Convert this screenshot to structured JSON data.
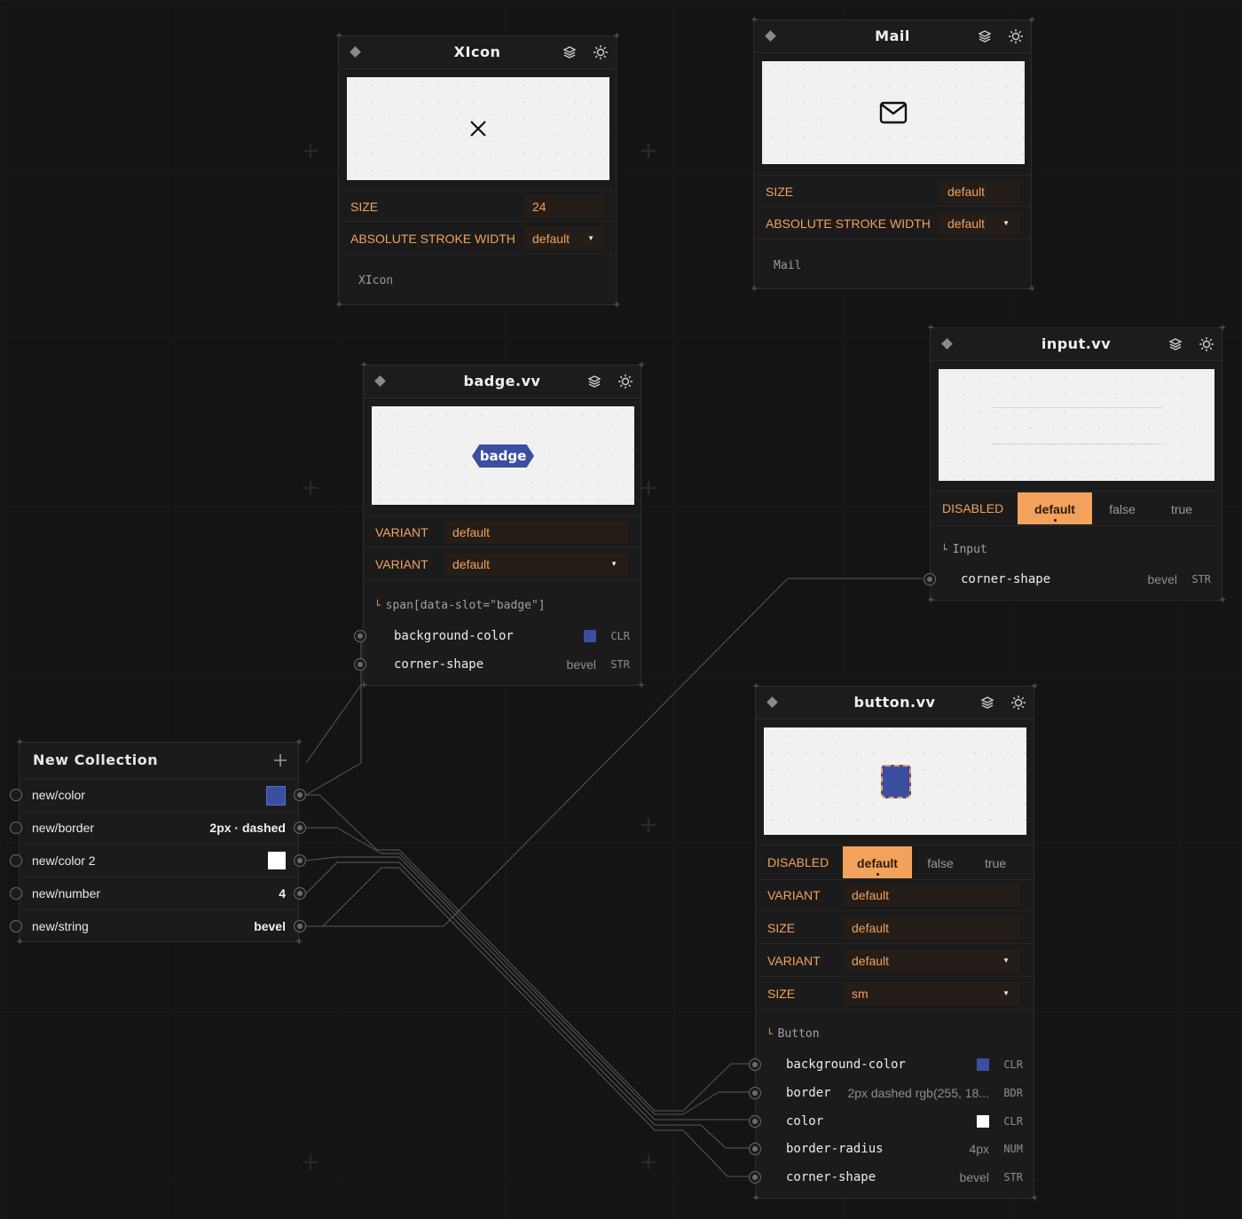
{
  "nodes": {
    "xicon": {
      "title": "XIcon",
      "size_label": "SIZE",
      "size_value": "24",
      "stroke_label": "ABSOLUTE STROKE WIDTH",
      "stroke_value": "default",
      "footer": "XIcon"
    },
    "mail": {
      "title": "Mail",
      "size_label": "SIZE",
      "size_value": "default",
      "stroke_label": "ABSOLUTE STROKE WIDTH",
      "stroke_value": "default",
      "footer": "Mail"
    },
    "badge": {
      "title": "badge.vv",
      "preview_text": "badge",
      "variant_label": "VARIANT",
      "variant_value": "default",
      "variant2_label": "VARIANT",
      "variant2_value": "default",
      "slot": "span[data-slot=\"badge\"]",
      "props": [
        {
          "name": "background-color",
          "type": "CLR",
          "swatch": "#3a4fa0"
        },
        {
          "name": "corner-shape",
          "value": "bevel",
          "type": "STR"
        }
      ]
    },
    "input": {
      "title": "input.vv",
      "disabled_label": "DISABLED",
      "tabs": [
        "default",
        "false",
        "true"
      ],
      "slot": "Input",
      "props": [
        {
          "name": "corner-shape",
          "value": "bevel",
          "type": "STR"
        }
      ]
    },
    "button": {
      "title": "button.vv",
      "disabled_label": "DISABLED",
      "tabs": [
        "default",
        "false",
        "true"
      ],
      "fields": [
        {
          "label": "VARIANT",
          "value": "default"
        },
        {
          "label": "SIZE",
          "value": "default"
        },
        {
          "label": "VARIANT",
          "value": "default"
        },
        {
          "label": "SIZE",
          "value": "sm"
        }
      ],
      "slot": "Button",
      "props": [
        {
          "name": "background-color",
          "type": "CLR",
          "swatch": "#3a4fa0"
        },
        {
          "name": "border",
          "value": "2px dashed rgb(255, 18...",
          "type": "BDR"
        },
        {
          "name": "color",
          "type": "CLR",
          "swatch": "#ffffff"
        },
        {
          "name": "border-radius",
          "value": "4px",
          "type": "NUM"
        },
        {
          "name": "corner-shape",
          "value": "bevel",
          "type": "STR"
        }
      ]
    }
  },
  "collection": {
    "title": "New Collection",
    "add_icon": "plus-icon",
    "rows": [
      {
        "key": "new/color",
        "swatch": "#3a4fa0"
      },
      {
        "key": "new/border",
        "value": "2px · dashed"
      },
      {
        "key": "new/color 2",
        "swatch": "#ffffff"
      },
      {
        "key": "new/number",
        "value": "4"
      },
      {
        "key": "new/string",
        "value": "bevel"
      }
    ]
  },
  "icons": {
    "header_left": "diamond-icon",
    "header_layers": "layers-icon",
    "header_theme": "sun-icon"
  },
  "colors": {
    "accent": "#f2a25c",
    "background": "#141414",
    "badge_blue": "#3a4fa0"
  }
}
